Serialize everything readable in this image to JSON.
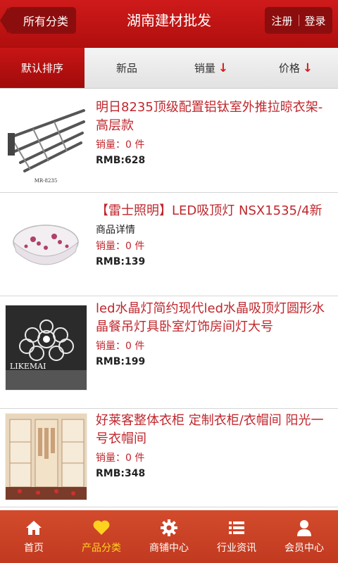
{
  "header": {
    "back_label": "所有分类",
    "title": "湖南建材批发",
    "register": "注册",
    "login": "登录"
  },
  "sort_tabs": [
    {
      "label": "默认排序",
      "active": true
    },
    {
      "label": "新品"
    },
    {
      "label": "销量",
      "arrow": "↓"
    },
    {
      "label": "价格",
      "arrow": "↓"
    }
  ],
  "products": [
    {
      "title": "明日8235顶级配置铝钛室外推拉晾衣架-高层款",
      "sales": "销量：0 件",
      "price": "RMB:628",
      "model": "MR-8235"
    },
    {
      "title": "【雷士照明】LED吸顶灯 NSX1535/4新",
      "detail": "商品详情",
      "sales": "销量：0 件",
      "price": "RMB:139"
    },
    {
      "title": "led水晶灯简约现代led水晶吸顶灯圆形水晶餐吊灯具卧室灯饰房间灯大号",
      "sales": "销量：0 件",
      "price": "RMB:199",
      "brand": "LIKEMAI"
    },
    {
      "title": "好莱客整体衣柜 定制衣柜/衣帽间 阳光一号衣帽间",
      "sales": "销量：0 件",
      "price": "RMB:348"
    }
  ],
  "tabbar": [
    {
      "label": "首页",
      "icon": "home-icon"
    },
    {
      "label": "产品分类",
      "icon": "heart-icon",
      "active": true
    },
    {
      "label": "商铺中心",
      "icon": "gear-icon"
    },
    {
      "label": "行业资讯",
      "icon": "list-icon"
    },
    {
      "label": "会员中心",
      "icon": "user-icon"
    }
  ],
  "colors": {
    "brand_red": "#c0272d",
    "tab_active": "#ffd21f"
  }
}
